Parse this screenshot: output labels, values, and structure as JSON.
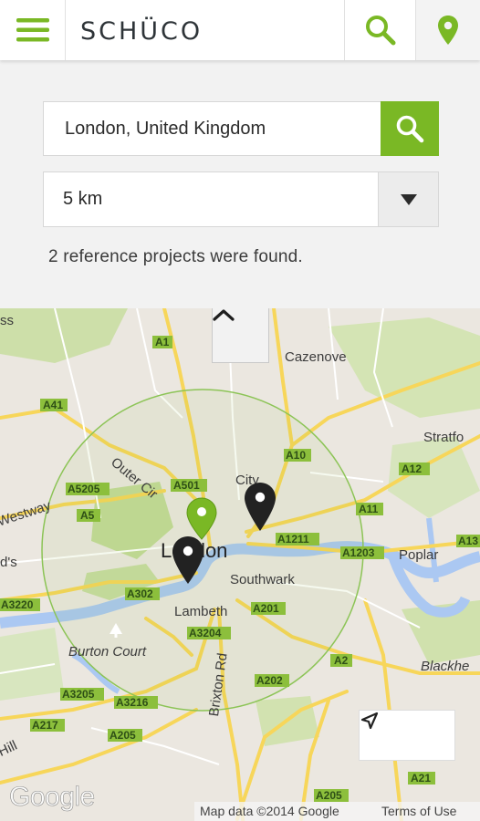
{
  "header": {
    "menu_icon": "hamburger-menu-icon",
    "logo_text": "SCHÜCO",
    "search_icon": "search-icon",
    "location_icon": "map-pin-icon",
    "accent_color": "#7ab825"
  },
  "search": {
    "location_value": "London, United Kingdom",
    "search_button_icon": "search-icon",
    "radius_value": "5 km",
    "radius_arrow_icon": "dropdown-triangle-icon",
    "result_text": "2 reference projects were found."
  },
  "map": {
    "collapse_icon": "chevron-up-icon",
    "mylocation_icon": "navigation-arrow-icon",
    "map_data_text": "Map data ©2014 Google",
    "terms_text": "Terms of Use",
    "google_logo_text": "Google",
    "labels": {
      "london": "London",
      "southwark": "Southwark",
      "lambeth": "Lambeth",
      "poplar": "Poplar",
      "cazenove": "Cazenove",
      "stratford": "Stratfo",
      "burton_court": "Burton Court",
      "blackheath": "Blackhe",
      "westway": "Westway",
      "brixton_rd": "Brixton Rd",
      "outer_circle": "Outer Cir",
      "city": "City",
      "ss": "ss",
      "ds": "d's",
      "hill": "Hill"
    },
    "roads": [
      "A1",
      "A41",
      "A10",
      "A5205",
      "A501",
      "A12",
      "A5",
      "A11",
      "A1211",
      "A1203",
      "A13",
      "A302",
      "A3220",
      "A201",
      "A3204",
      "A2",
      "A3205",
      "A3216",
      "A202",
      "A217",
      "A205",
      "A205",
      "A21"
    ],
    "pins": [
      {
        "name": "selected-project-pin",
        "color": "#7ab825"
      },
      {
        "name": "project-pin-east",
        "color": "#222222"
      },
      {
        "name": "project-pin-west",
        "color": "#222222"
      }
    ]
  }
}
